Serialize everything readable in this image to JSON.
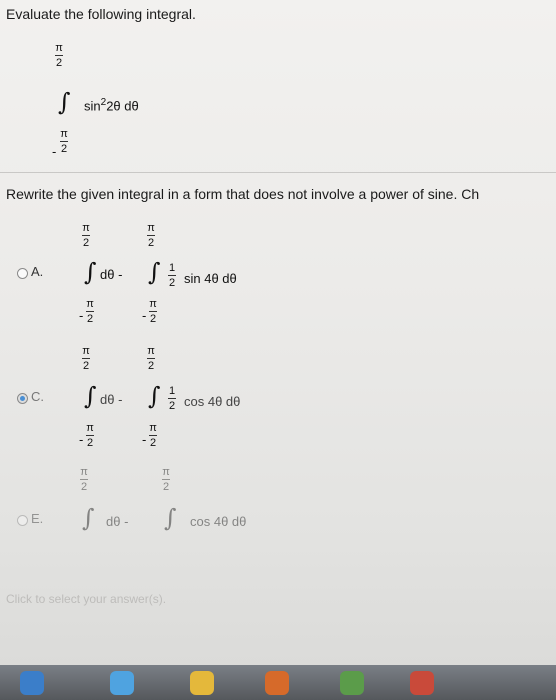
{
  "question": {
    "heading": "Evaluate the following integral.",
    "integrand": "sin",
    "power": "2",
    "argument": "2θ dθ",
    "limit_top_num": "π",
    "limit_top_den": "2",
    "limit_bot_num": "π",
    "limit_bot_den": "2",
    "minus": "-"
  },
  "prompt": {
    "text": "Rewrite the given integral in a form that does not involve a power of sine. Ch"
  },
  "options": {
    "a": {
      "label": "A.",
      "term1": "dθ -",
      "term2_num": "1",
      "term2_den": "2",
      "term2_func": "sin 4θ dθ",
      "pi": "π",
      "two": "2",
      "minus": "-"
    },
    "c": {
      "label": "C.",
      "selected": true,
      "term1": "dθ -",
      "term2_num": "1",
      "term2_den": "2",
      "term2_func": "cos 4θ dθ",
      "pi": "π",
      "two": "2",
      "minus": "-"
    },
    "e": {
      "label": "E.",
      "term1": "dθ -",
      "term2_func": "cos 4θ dθ",
      "pi": "π",
      "two": "2"
    }
  },
  "footer": {
    "hint": "Click to select your answer(s)."
  },
  "colors": {
    "selected_radio": "#4a8fd4",
    "background": "#eeeeec"
  }
}
